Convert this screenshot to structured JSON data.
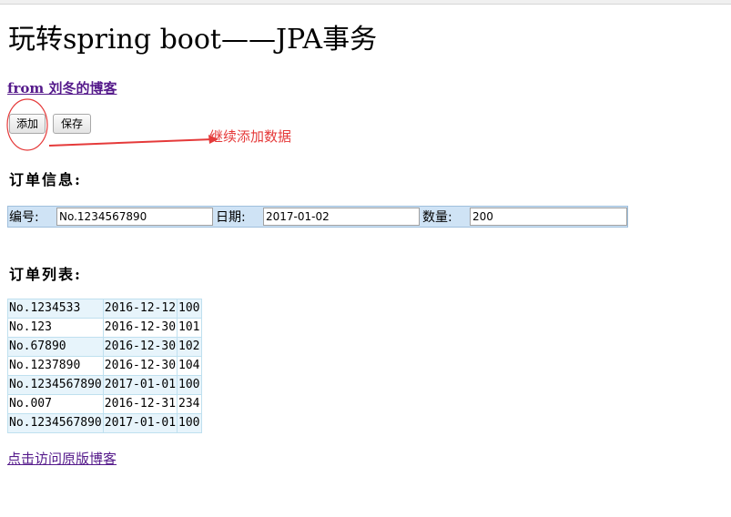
{
  "page": {
    "title": "玩转spring boot——JPA事务",
    "from_link": "from 刘冬的博客",
    "buttons": {
      "add": "添加",
      "save": "保存"
    },
    "annotation": "继续添加数据",
    "order_info_heading": "订单信息:",
    "form": {
      "number_label": "编号:",
      "number_value": "No.1234567890",
      "date_label": "日期:",
      "date_value": "2017-01-02",
      "quantity_label": "数量:",
      "quantity_value": "200"
    },
    "order_list_heading": "订单列表:",
    "orders": [
      {
        "no": "No.1234533",
        "date": "2016-12-12",
        "qty": "100"
      },
      {
        "no": "No.123",
        "date": "2016-12-30",
        "qty": "101"
      },
      {
        "no": "No.67890",
        "date": "2016-12-30",
        "qty": "102"
      },
      {
        "no": "No.1237890",
        "date": "2016-12-30",
        "qty": "104"
      },
      {
        "no": "No.1234567890",
        "date": "2017-01-01",
        "qty": "100"
      },
      {
        "no": "No.007",
        "date": "2016-12-31",
        "qty": "234"
      },
      {
        "no": "No.1234567890",
        "date": "2017-01-01",
        "qty": "100"
      }
    ],
    "visit_link": "点击访问原版博客"
  },
  "colors": {
    "annotation": "#e53a3a",
    "link": "#551a8b",
    "row_band": "#e7f4fb",
    "form_bg": "#cfe3f5"
  }
}
